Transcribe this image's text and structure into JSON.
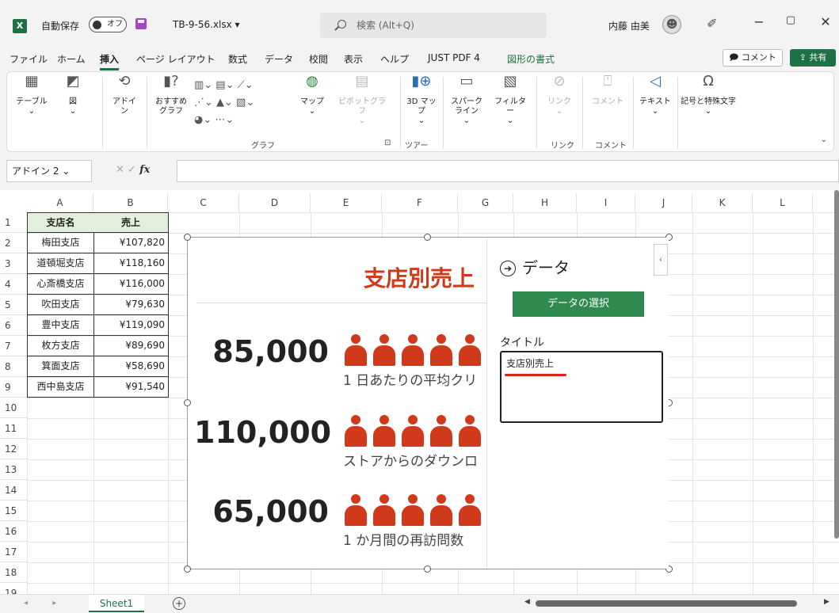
{
  "titlebar": {
    "app_icon": "excel-logo-icon",
    "autosave_label": "自動保存",
    "autosave_state": "オフ",
    "filename": "TB-9-56.xlsx ▾",
    "search_placeholder": "検索 (Alt+Q)",
    "user_name": "内藤 由美",
    "avatar_glyph": "Ȓ",
    "pen_glyph": "✐",
    "minimize": "−",
    "restore": "▢",
    "close": "✕"
  },
  "menu": {
    "tabs": [
      "ファイル",
      "ホーム",
      "挿入",
      "ページ レイアウト",
      "数式",
      "データ",
      "校閲",
      "表示",
      "ヘルプ",
      "JUST PDF 4",
      "図形の書式"
    ],
    "active_index": 2,
    "comment_label": "🗩 コメント",
    "share_label": "⇪ 共有"
  },
  "ribbon": {
    "table": "テーブル",
    "illustrations": "図",
    "addins": "アドイン",
    "recommended_charts": "おすすめグラフ",
    "maps": "マップ",
    "pivot_chart": "ピボットグラフ",
    "map3d": "3D マップ",
    "sparklines": "スパークライン",
    "filters": "フィルター",
    "link": "リンク",
    "comment": "コメント",
    "text": "テキスト",
    "symbols": "記号と特殊文字",
    "group_chart": "グラフ",
    "group_tour": "ツアー",
    "group_link": "リンク",
    "group_comment": "コメント"
  },
  "formula": {
    "name_box": "アドイン 2",
    "fx": "fx",
    "cancel_glyph": "✕",
    "enter_glyph": "✓"
  },
  "columns": [
    "A",
    "B",
    "C",
    "D",
    "E",
    "F",
    "G",
    "H",
    "I",
    "J",
    "K",
    "L"
  ],
  "rows": [
    "1",
    "2",
    "3",
    "4",
    "5",
    "6",
    "7",
    "8",
    "9",
    "10",
    "11",
    "12",
    "13",
    "14",
    "15",
    "16",
    "17",
    "18",
    "19"
  ],
  "table": {
    "header_a": "支店名",
    "header_b": "売上",
    "rows": [
      {
        "name": "梅田支店",
        "value": "¥107,820"
      },
      {
        "name": "道頓堀支店",
        "value": "¥118,160"
      },
      {
        "name": "心斎橋支店",
        "value": "¥116,000"
      },
      {
        "name": "吹田支店",
        "value": "¥79,630"
      },
      {
        "name": "豊中支店",
        "value": "¥119,090"
      },
      {
        "name": "枚方支店",
        "value": "¥89,690"
      },
      {
        "name": "箕面支店",
        "value": "¥58,690"
      },
      {
        "name": "西中島支店",
        "value": "¥91,540"
      }
    ]
  },
  "chart": {
    "title": "支店別売上",
    "stats": [
      {
        "number": "85,000",
        "caption": "1 日あたりの平均クリ"
      },
      {
        "number": "110,000",
        "caption": "ストアからのダウンロ"
      },
      {
        "number": "65,000",
        "caption": "1 か月間の再訪問数"
      }
    ],
    "accent": "#d03a1b"
  },
  "pane": {
    "heading": "データ",
    "select_data": "データの選択",
    "title_label": "タイトル",
    "title_value": "支店別売上",
    "collapse": "‹"
  },
  "sheetbar": {
    "sheet_name": "Sheet1",
    "add_sheet": "+",
    "nav": "◂ ▸"
  }
}
